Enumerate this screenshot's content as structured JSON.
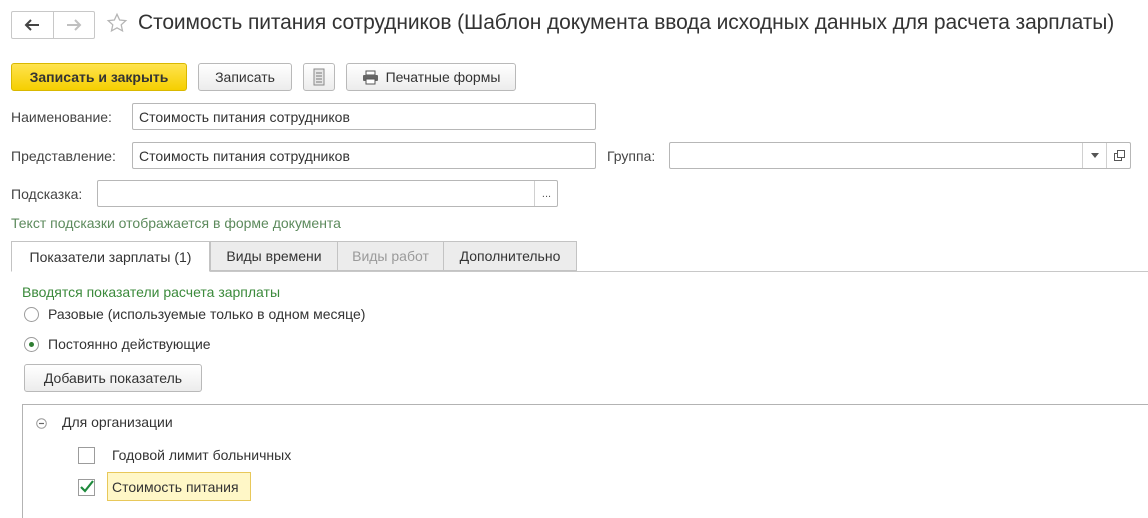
{
  "header": {
    "back_icon": "arrow-left-icon",
    "forward_icon": "arrow-right-icon",
    "favorite_icon": "star-icon",
    "title": "Стоимость питания сотрудников (Шаблон документа ввода исходных данных для расчета зарплаты)"
  },
  "toolbar": {
    "save_close_label": "Записать и закрыть",
    "save_label": "Записать",
    "report_icon": "document-list-icon",
    "print_icon": "printer-icon",
    "print_label": "Печатные формы"
  },
  "form": {
    "name_label": "Наименование:",
    "name_value": "Стоимость питания сотрудников",
    "presentation_label": "Представление:",
    "presentation_value": "Стоимость питания сотрудников",
    "group_label": "Группа:",
    "group_value": "",
    "hint_label": "Подсказка:",
    "hint_value": "",
    "hint_button": "...",
    "hint_note": "Текст подсказки отображается в форме документа"
  },
  "tabs": [
    {
      "label": "Показатели зарплаты (1)",
      "active": true
    },
    {
      "label": "Виды времени",
      "active": false
    },
    {
      "label": "Виды работ",
      "active": false,
      "disabled": true
    },
    {
      "label": "Дополнительно",
      "active": false
    }
  ],
  "indicators": {
    "section_title": "Вводятся показатели расчета зарплаты",
    "radio_one_time": "Разовые (используемые только в одном месяце)",
    "radio_permanent": "Постоянно действующие",
    "selected_radio": "permanent",
    "add_button": "Добавить показатель",
    "tree": {
      "group_label": "Для организации",
      "items": [
        {
          "label": "Годовой лимит больничных",
          "checked": false
        },
        {
          "label": "Стоимость питания",
          "checked": true
        }
      ]
    }
  },
  "colors": {
    "primary_button": "#f5cf00",
    "section_title": "#3b8a3b",
    "selected_highlight": "#fff7c7"
  }
}
